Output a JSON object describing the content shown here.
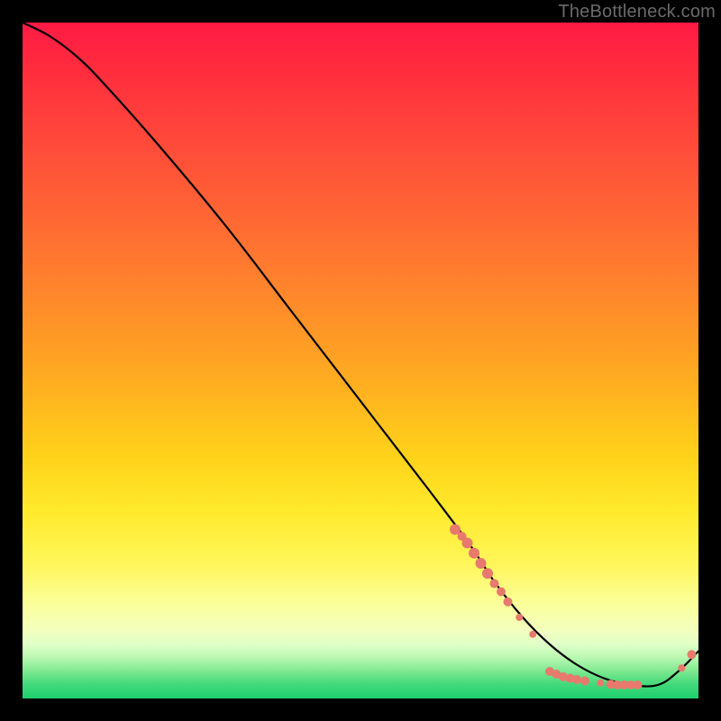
{
  "watermark": "TheBottleneck.com",
  "chart_data": {
    "type": "line",
    "title": "",
    "xlabel": "",
    "ylabel": "",
    "xlim": [
      0,
      100
    ],
    "ylim": [
      0,
      100
    ],
    "grid": false,
    "legend": false,
    "series": [
      {
        "name": "curve",
        "color": "#000000",
        "x": [
          0,
          4,
          8,
          12,
          20,
          30,
          40,
          50,
          60,
          66,
          70,
          74,
          78,
          82,
          86,
          90,
          94,
          97,
          100
        ],
        "y": [
          100,
          98,
          95,
          91,
          82,
          70,
          57,
          44,
          31,
          23,
          17,
          12,
          8,
          5,
          3,
          2,
          2,
          4,
          7
        ]
      }
    ],
    "markers": {
      "note": "Salmon dot markers along lower portion of the curve",
      "color": "#e77a6d",
      "radius_small": 4,
      "radius_large": 6,
      "points": [
        {
          "x": 64.0,
          "y": 25.0,
          "r": 6
        },
        {
          "x": 65.0,
          "y": 24.0,
          "r": 5
        },
        {
          "x": 65.8,
          "y": 23.0,
          "r": 6
        },
        {
          "x": 66.8,
          "y": 21.5,
          "r": 6
        },
        {
          "x": 67.8,
          "y": 20.0,
          "r": 6
        },
        {
          "x": 68.8,
          "y": 18.5,
          "r": 6
        },
        {
          "x": 69.8,
          "y": 17.0,
          "r": 5
        },
        {
          "x": 70.8,
          "y": 15.8,
          "r": 5
        },
        {
          "x": 71.8,
          "y": 14.3,
          "r": 5
        },
        {
          "x": 73.5,
          "y": 12.0,
          "r": 4
        },
        {
          "x": 75.5,
          "y": 9.5,
          "r": 4
        },
        {
          "x": 78.0,
          "y": 4.0,
          "r": 5
        },
        {
          "x": 79.0,
          "y": 3.6,
          "r": 5
        },
        {
          "x": 80.0,
          "y": 3.2,
          "r": 5
        },
        {
          "x": 81.0,
          "y": 3.0,
          "r": 5
        },
        {
          "x": 82.0,
          "y": 2.8,
          "r": 5
        },
        {
          "x": 83.2,
          "y": 2.6,
          "r": 5
        },
        {
          "x": 85.5,
          "y": 2.3,
          "r": 4
        },
        {
          "x": 87.0,
          "y": 2.1,
          "r": 5
        },
        {
          "x": 88.0,
          "y": 2.0,
          "r": 5
        },
        {
          "x": 89.0,
          "y": 2.0,
          "r": 5
        },
        {
          "x": 90.0,
          "y": 2.0,
          "r": 5
        },
        {
          "x": 91.0,
          "y": 2.0,
          "r": 5
        },
        {
          "x": 97.5,
          "y": 4.5,
          "r": 4
        },
        {
          "x": 99.0,
          "y": 6.5,
          "r": 5
        }
      ]
    }
  }
}
